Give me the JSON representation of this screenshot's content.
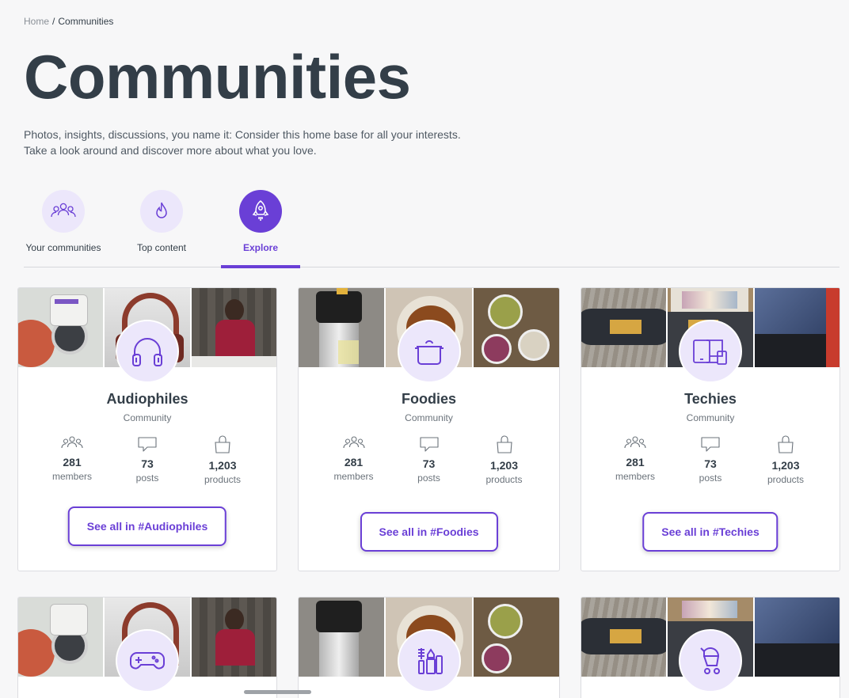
{
  "breadcrumb": {
    "home": "Home",
    "separator": "/",
    "current": "Communities"
  },
  "page": {
    "title": "Communities",
    "intro_line1": "Photos, insights, discussions, you name it: Consider this home base for all your interests.",
    "intro_line2": "Take a look around and discover more about what you love."
  },
  "tabs": [
    {
      "label": "Your communities",
      "icon": "people-icon",
      "active": false
    },
    {
      "label": "Top content",
      "icon": "flame-icon",
      "active": false
    },
    {
      "label": "Explore",
      "icon": "rocket-icon",
      "active": true
    }
  ],
  "colors": {
    "accent": "#6a3fd6",
    "accent_light": "#ece7fb",
    "text": "#333e48"
  },
  "cards": [
    {
      "name": "Audiophiles",
      "type": "Community",
      "icon": "headphones-icon",
      "members": "281",
      "members_label": "members",
      "posts": "73",
      "posts_label": "posts",
      "products": "1,203",
      "products_label": "products",
      "button": "See all in #Audiophiles"
    },
    {
      "name": "Foodies",
      "type": "Community",
      "icon": "cooking-pot-icon",
      "members": "281",
      "members_label": "members",
      "posts": "73",
      "posts_label": "posts",
      "products": "1,203",
      "products_label": "products",
      "button": "See all in #Foodies"
    },
    {
      "name": "Techies",
      "type": "Community",
      "icon": "devices-icon",
      "members": "281",
      "members_label": "members",
      "posts": "73",
      "posts_label": "posts",
      "products": "1,203",
      "products_label": "products",
      "button": "See all in #Techies"
    },
    {
      "icon": "gamepad-icon"
    },
    {
      "icon": "makeup-icon"
    },
    {
      "icon": "stroller-icon"
    }
  ]
}
